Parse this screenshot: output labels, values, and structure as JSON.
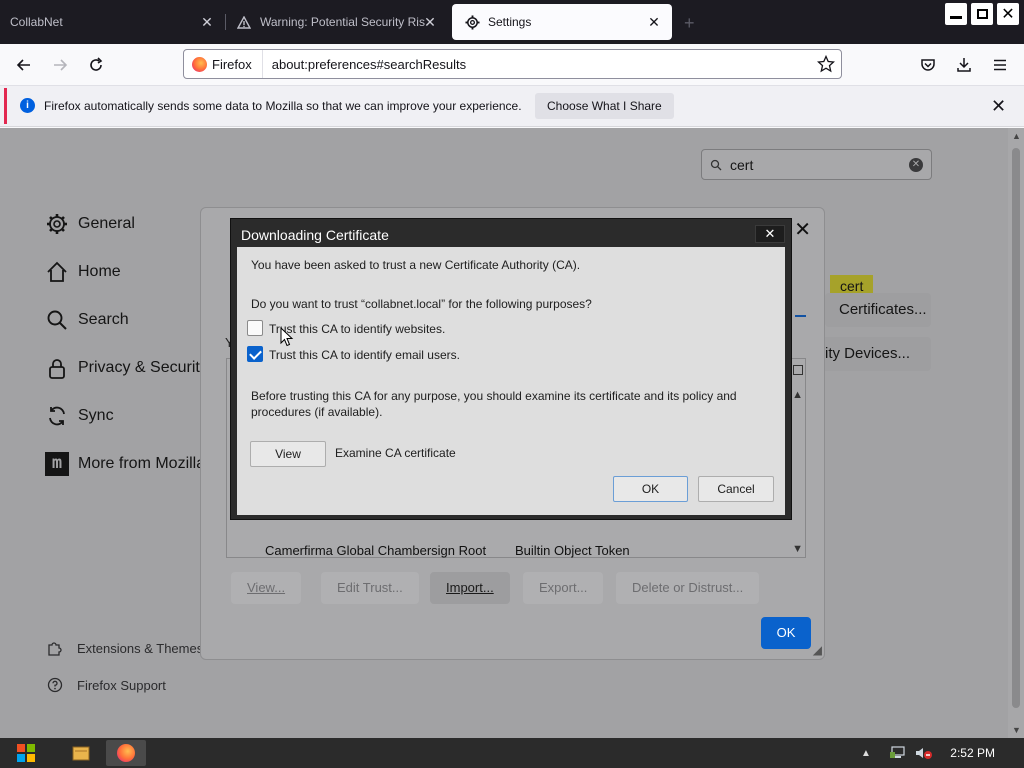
{
  "tabs": [
    {
      "label": "CollabNet"
    },
    {
      "label": "Warning: Potential Security Risk Ahead"
    },
    {
      "label": "Settings"
    }
  ],
  "urlbar": {
    "identity_label": "Firefox",
    "url": "about:preferences#searchResults"
  },
  "notification": {
    "message": "Firefox automatically sends some data to Mozilla so that we can improve your experience.",
    "button_label": "Choose What I Share"
  },
  "search": {
    "query": "cert"
  },
  "sidebar": {
    "items": [
      {
        "label": "General",
        "icon": "gear-icon"
      },
      {
        "label": "Home",
        "icon": "home-icon"
      },
      {
        "label": "Search",
        "icon": "search-icon"
      },
      {
        "label": "Privacy & Security",
        "icon": "lock-icon"
      },
      {
        "label": "Sync",
        "icon": "sync-icon"
      },
      {
        "label": "More from Mozilla",
        "icon": "mozilla-icon"
      }
    ],
    "footer": [
      {
        "label": "Extensions & Themes",
        "icon": "puzzle-icon"
      },
      {
        "label": "Firefox Support",
        "icon": "help-icon"
      }
    ]
  },
  "background_buttons": {
    "highlight": "cert",
    "view_certificates": "Certificates...",
    "security_devices": "rity Devices..."
  },
  "cert_manager": {
    "partial_label": "Y",
    "row": {
      "name": "Camerfirma Global Chambersign Root",
      "device": "Builtin Object Token"
    },
    "buttons": {
      "view": "View...",
      "edit_trust": "Edit Trust...",
      "import": "Import...",
      "export": "Export...",
      "delete": "Delete or Distrust..."
    },
    "ok": "OK"
  },
  "download_dialog": {
    "title": "Downloading Certificate",
    "intro": "You have been asked to trust a new Certificate Authority (CA).",
    "question": "Do you want to trust “collabnet.local” for the following purposes?",
    "options": [
      {
        "label": "Trust this CA to identify websites.",
        "checked": false
      },
      {
        "label": "Trust this CA to identify email users.",
        "checked": true
      }
    ],
    "warning": "Before trusting this CA for any purpose, you should examine its certificate and its policy and procedures (if available).",
    "view_button": "View",
    "view_description": "Examine CA certificate",
    "ok_button": "OK",
    "cancel_button": "Cancel"
  },
  "taskbar": {
    "clock": "2:52 PM"
  },
  "colors": {
    "accent": "#0060df",
    "ok_blue": "#0a62cc",
    "notification_stripe": "#e22850"
  }
}
